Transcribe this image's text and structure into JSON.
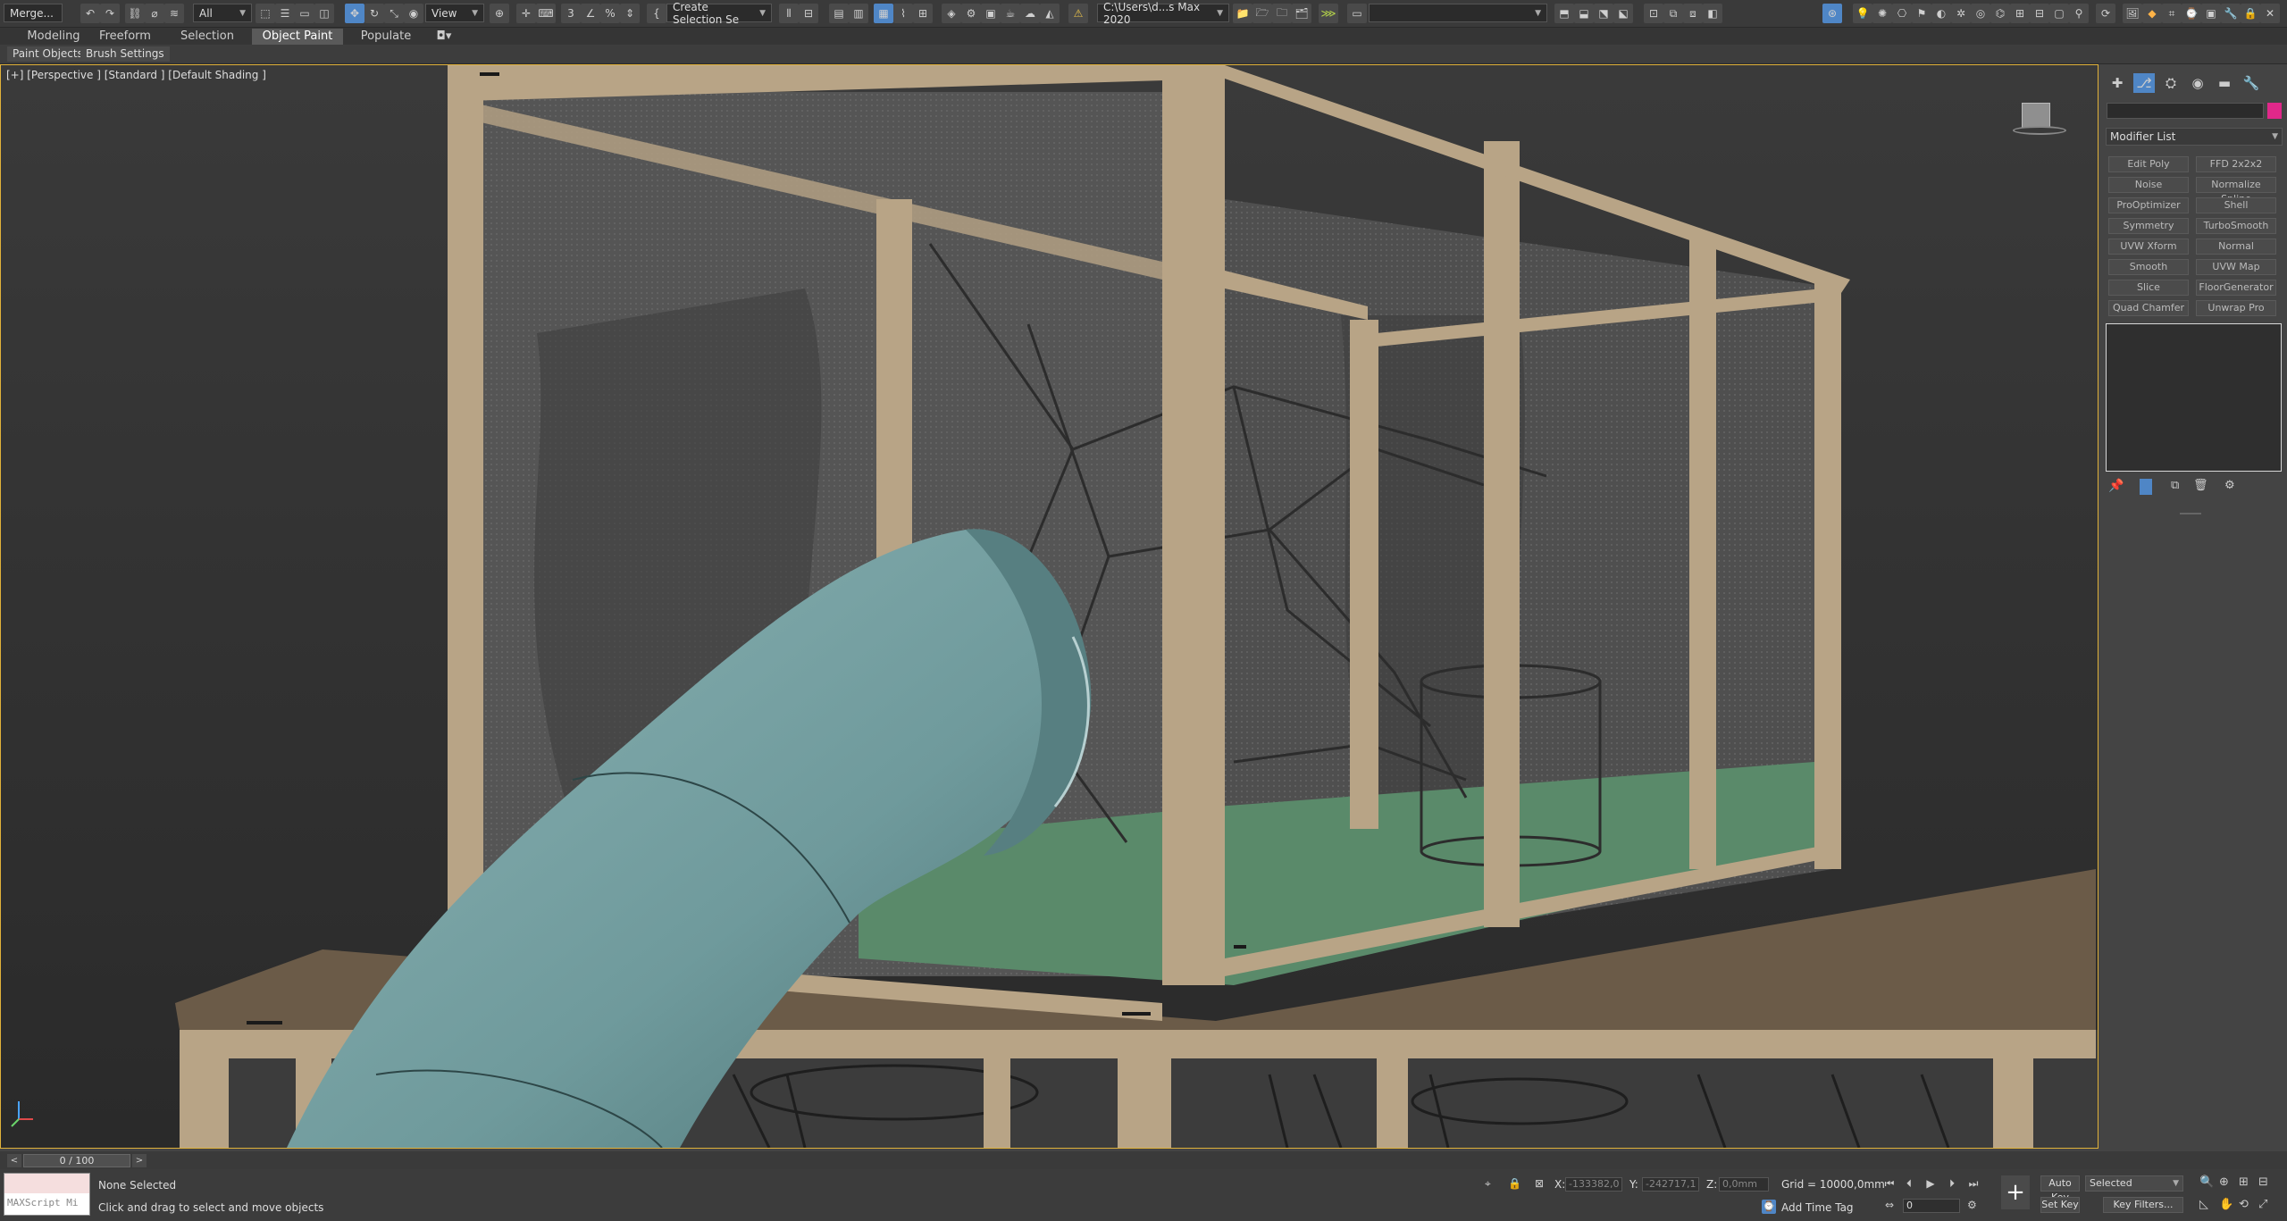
{
  "toolbar": {
    "merge_label": "Merge...",
    "selection_filter": "All",
    "ref_coord": "View",
    "create_selection_set": "Create Selection Se",
    "file_path": "C:\\Users\\d...s Max 2020",
    "workspace_dropdown": ""
  },
  "ribbon": {
    "tabs": [
      "Modeling",
      "Freeform",
      "Selection",
      "Object Paint",
      "Populate"
    ],
    "active_tab": "Object Paint"
  },
  "subbar": {
    "paint_objects": "Paint Objects",
    "brush_settings": "Brush Settings"
  },
  "viewport": {
    "label": "[+] [Perspective ] [Standard ] [Default Shading ]",
    "slide_color": "#6f9a9c",
    "frame_color": "#b8a486",
    "floor_color": "#5a8a6a"
  },
  "command_panel": {
    "name_value": "",
    "object_color": "#e0288a",
    "modifier_list_label": "Modifier List",
    "modifiers": [
      [
        "Edit Poly",
        "FFD 2x2x2"
      ],
      [
        "Noise",
        "Normalize Spline"
      ],
      [
        "ProOptimizer",
        "Shell"
      ],
      [
        "Symmetry",
        "TurboSmooth"
      ],
      [
        "UVW Xform",
        "Normal"
      ],
      [
        "Smooth",
        "UVW Map"
      ],
      [
        "Slice",
        "FloorGenerator"
      ],
      [
        "Quad Chamfer",
        "Unwrap Pro"
      ]
    ]
  },
  "timeline": {
    "slider_label": "0 / 100"
  },
  "status": {
    "maxscript_placeholder": "MAXScript Mi",
    "selection_status": "None Selected",
    "prompt": "Click and drag to select and move objects",
    "x_label": "X:",
    "x_value": "-133382,0",
    "y_label": "Y:",
    "y_value": "-242717,1",
    "z_label": "Z:",
    "z_value": "0,0mm",
    "grid": "Grid = 10000,0mm",
    "add_time_tag": "Add Time Tag",
    "auto_key": "Auto Key",
    "set_key": "Set Key",
    "selected_dropdown": "Selected",
    "key_filters": "Key Filters...",
    "frame_field": "0"
  }
}
